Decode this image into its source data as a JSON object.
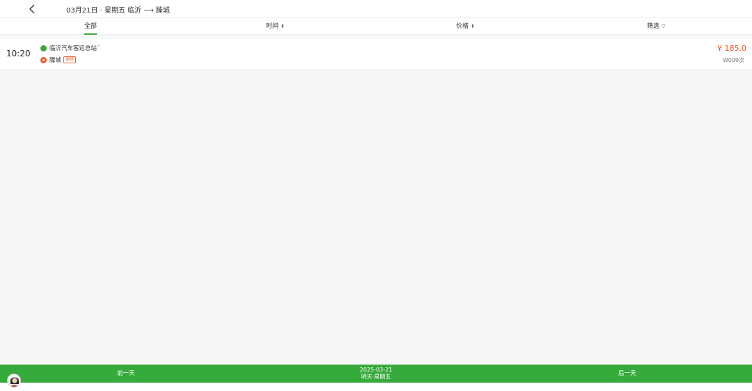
{
  "header": {
    "title": "03月21日 · 星期五 临沂 ⟶ 滕城"
  },
  "tabs": [
    {
      "label": "全部",
      "icon": ""
    },
    {
      "label": "时间",
      "icon": "sort-icon"
    },
    {
      "label": "价格",
      "icon": "sort-icon"
    },
    {
      "label": "筛选",
      "icon": "filter-icon"
    }
  ],
  "trip": {
    "time": "10:20",
    "from": "临沂汽车客运总站",
    "to": "滕城",
    "badge": "途经",
    "price": "¥ 185.0",
    "code": "W099次"
  },
  "bottom": {
    "prev_label": "前一天",
    "next_label": "后一天",
    "date": "2025-03-21",
    "weekday": "明天·星期五"
  },
  "colors": {
    "accent": "#3aa83a",
    "price": "#f05a28",
    "bar": "#36aa3a"
  }
}
